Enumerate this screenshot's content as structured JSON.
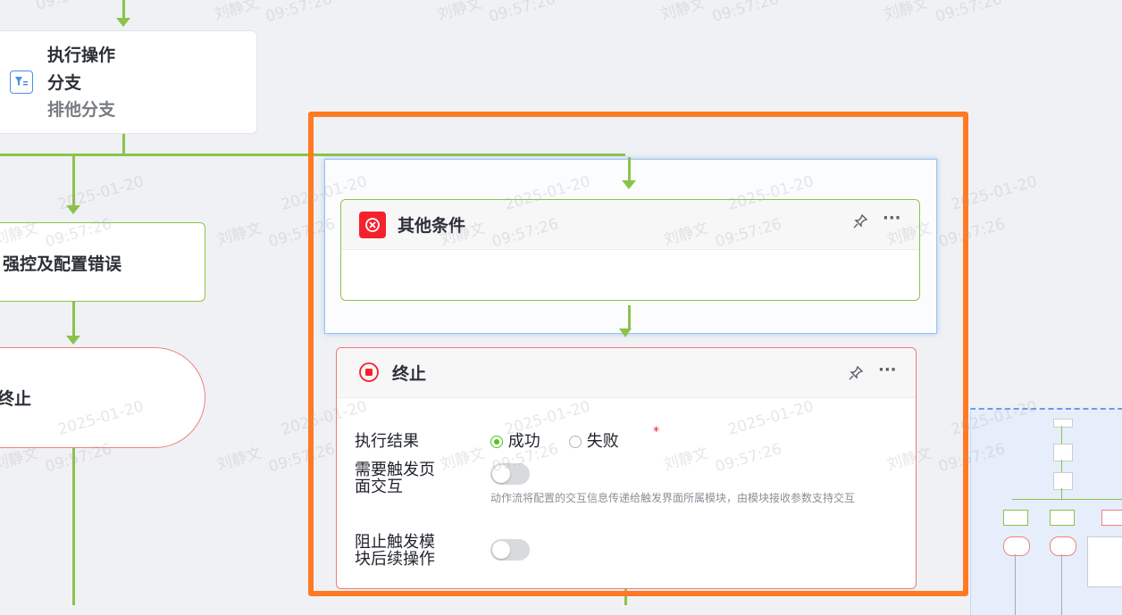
{
  "left_flow": {
    "branch_node": {
      "title_line1": "执行操作",
      "title_line2": "分支",
      "subtitle": "排他分支"
    },
    "action_node": {
      "label": "强控及配置错误"
    },
    "end_node": {
      "label": "终止"
    }
  },
  "right_flow": {
    "other_condition": {
      "title": "其他条件"
    },
    "terminate": {
      "title": "终止",
      "fields": {
        "result_label": "执行结果",
        "result_options": [
          "成功",
          "失败"
        ],
        "result_selected": "成功",
        "required_mark": "*",
        "trigger_page_label_line1": "需要触发页",
        "trigger_page_label_line2": "面交互",
        "trigger_page_help": "动作流将配置的交互信息传递给触发界面所属模块，由模块接收参数支持交互",
        "trigger_page_on": false,
        "block_label_line1": "阻止触发模",
        "block_label_line2": "块后续操作",
        "block_on": false
      }
    }
  },
  "watermark": {
    "name": "刘静文",
    "date": "2025-01-20",
    "time": "09:57:26"
  },
  "colors": {
    "green": "#8bc34a",
    "orange": "#ff7a22",
    "red": "#f5222d",
    "blue": "#7bb0ee"
  }
}
